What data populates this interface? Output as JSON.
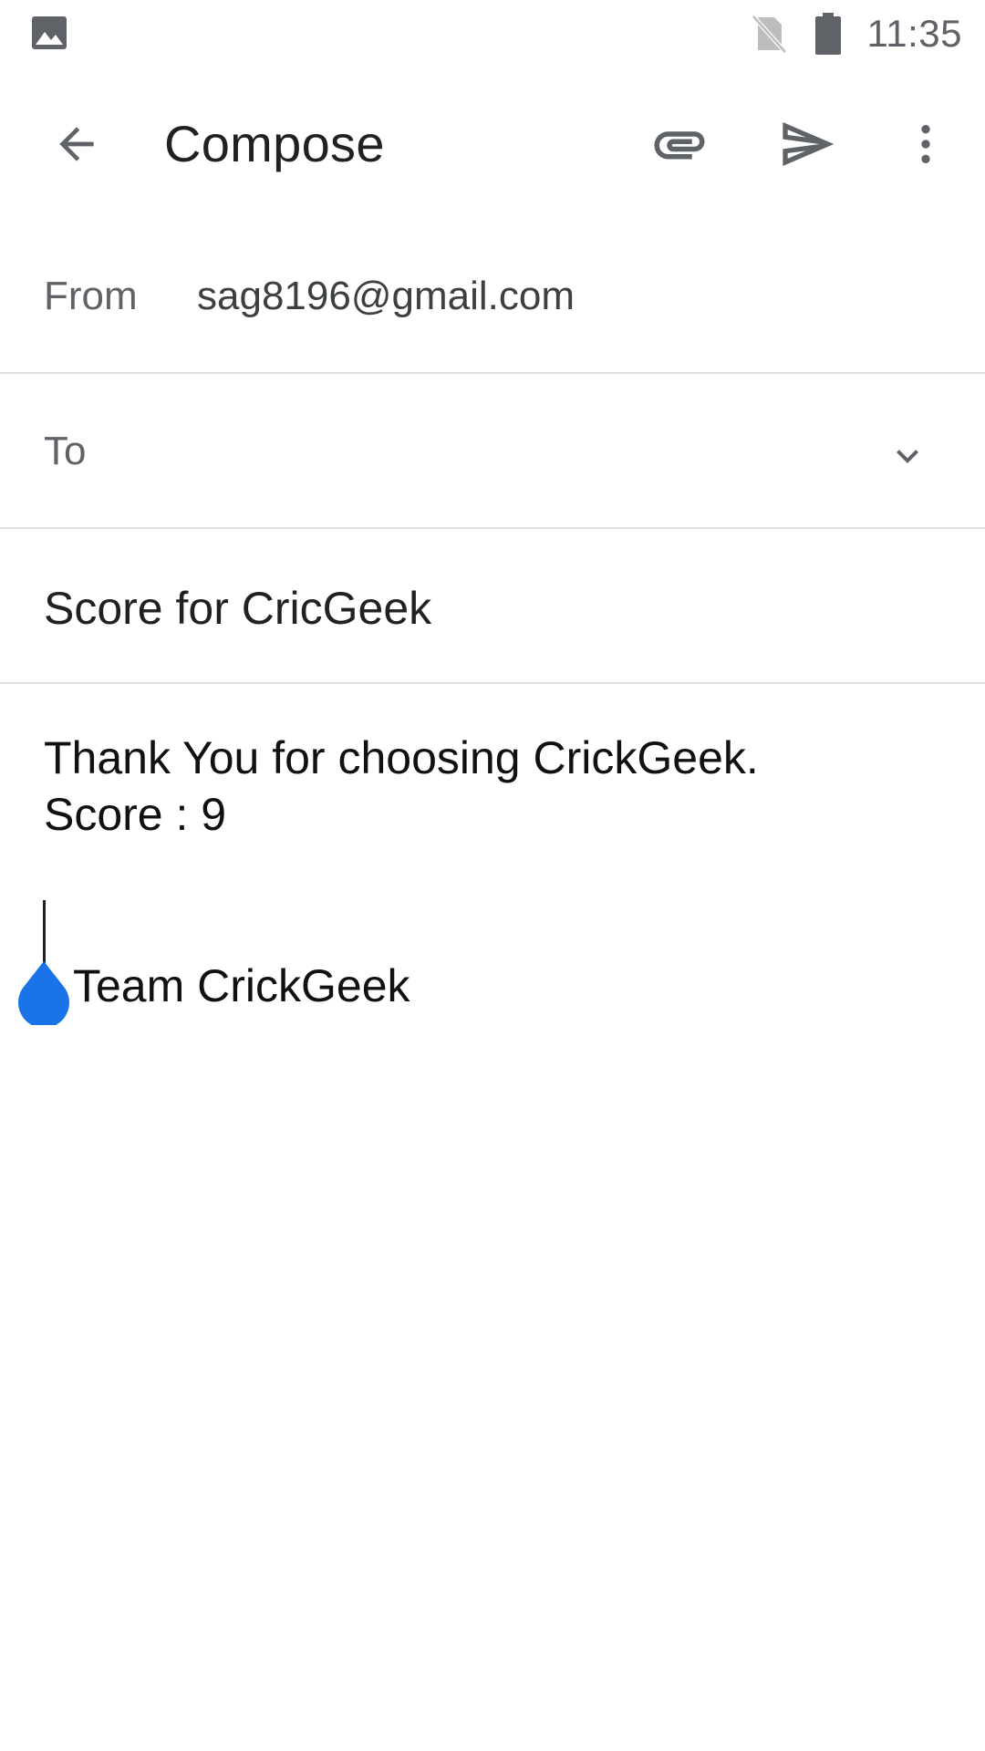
{
  "status_bar": {
    "time": "11:35",
    "icons": [
      "gallery-icon",
      "no-sim-icon",
      "battery-icon"
    ]
  },
  "app_bar": {
    "title": "Compose",
    "icons": [
      "back-arrow-icon",
      "attachment-icon",
      "send-icon",
      "more-vertical-icon"
    ]
  },
  "compose": {
    "from_label": "From",
    "from_value": "sag8196@gmail.com",
    "to_label": "To",
    "to_value": "",
    "subject": "Score for CricGeek",
    "body_lines": [
      "Thank You for choosing CrickGeek.",
      "Score : 9",
      "",
      "Team CrickGeek"
    ]
  },
  "colors": {
    "icon": "#5f6368",
    "text_primary": "#202124",
    "divider": "#e0e0e0",
    "cursor_handle": "#1a73e8"
  }
}
